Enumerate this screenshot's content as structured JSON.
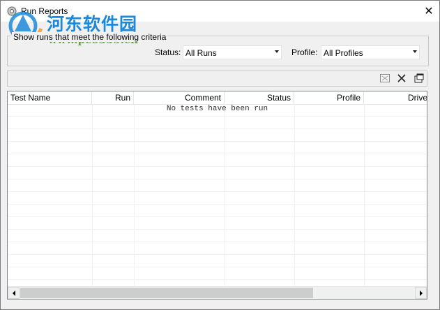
{
  "window": {
    "title": "Run Reports",
    "close_glyph": "✕"
  },
  "watermark": {
    "brand": "河东软件园",
    "url": "www.pc0359.cn"
  },
  "criteria": {
    "legend": "Show runs that meet the following criteria",
    "status_label": "Status:",
    "status_value": "All Runs",
    "profile_label": "Profile:",
    "profile_value": "All Profiles"
  },
  "toolbar": {
    "icons": [
      "report-icon",
      "delete-icon",
      "properties-icon"
    ]
  },
  "table": {
    "columns": [
      "Test Name",
      "Run",
      "Comment",
      "Status",
      "Profile",
      "Drive"
    ],
    "empty_message": "No tests have been run"
  },
  "colors": {
    "brand_blue": "#1e88d8",
    "url_green": "#5fa83c"
  }
}
